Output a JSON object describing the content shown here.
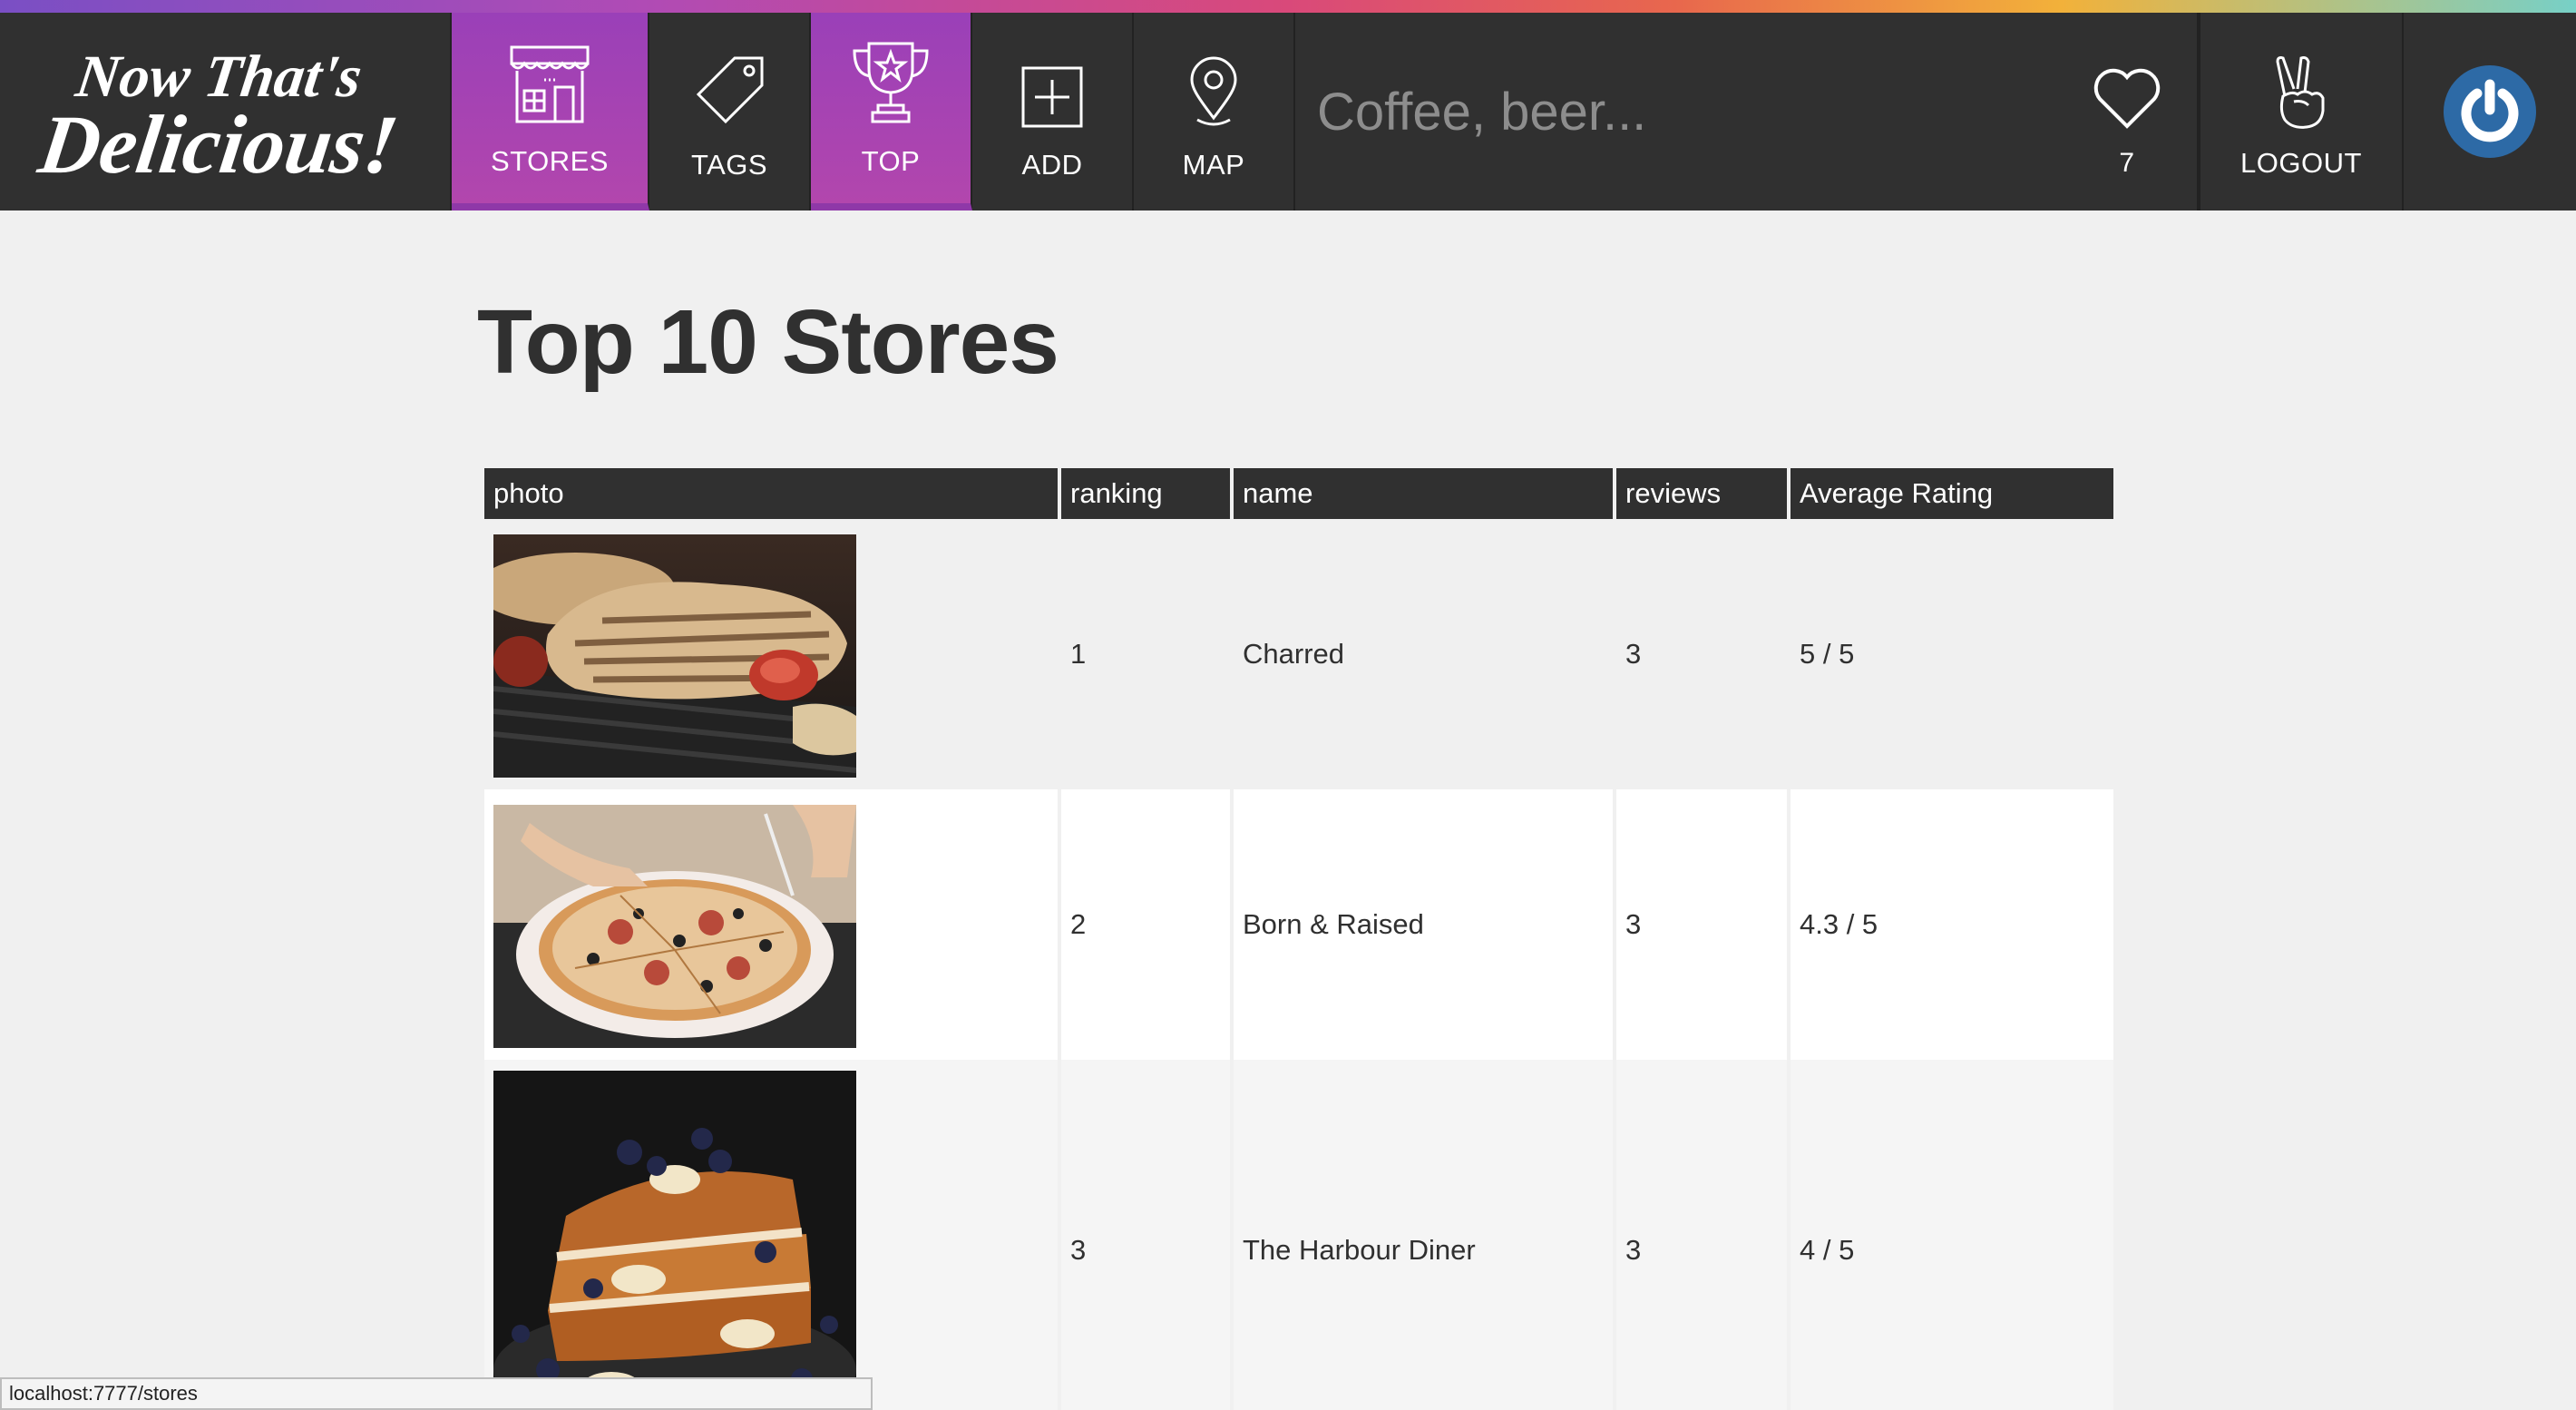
{
  "brand": {
    "logo_line1": "Now That's",
    "logo_line2": "Delicious!"
  },
  "nav": {
    "stores": "STORES",
    "tags": "TAGS",
    "top": "TOP",
    "add": "ADD",
    "map": "MAP",
    "hearts_count": "7",
    "logout": "LOGOUT"
  },
  "search": {
    "placeholder": "Coffee, beer..."
  },
  "page": {
    "title": "Top 10 Stores"
  },
  "table": {
    "headers": [
      "photo",
      "ranking",
      "name",
      "reviews",
      "Average Rating"
    ],
    "rows": [
      {
        "ranking": "1",
        "name": "Charred",
        "reviews": "3",
        "rating": "5 / 5",
        "photo": "grilled-chicken-photo"
      },
      {
        "ranking": "2",
        "name": "Born & Raised",
        "reviews": "3",
        "rating": "4.3 / 5",
        "photo": "pizza-photo"
      },
      {
        "ranking": "3",
        "name": "The Harbour Diner",
        "reviews": "3",
        "rating": "4 / 5",
        "photo": "french-toast-photo"
      }
    ]
  },
  "status": {
    "url": "localhost:7777/stores"
  },
  "colors": {
    "nav_bg": "#303030",
    "active_purple": "#a444b3",
    "avatar_blue": "#2d6aa6"
  }
}
